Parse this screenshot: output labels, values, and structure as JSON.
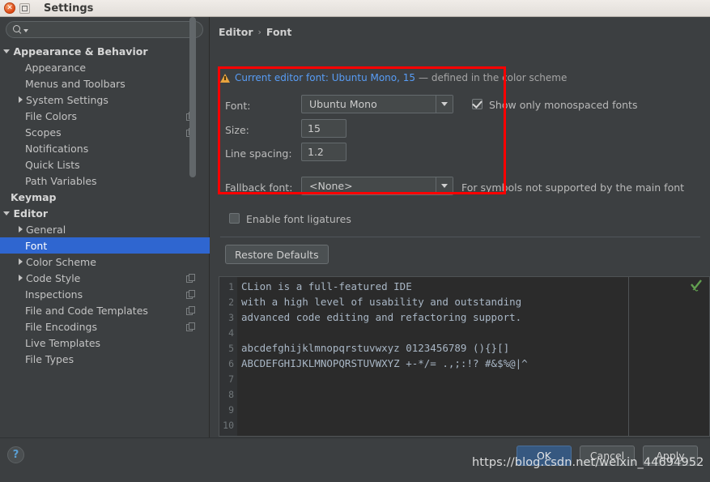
{
  "window": {
    "title": "Settings",
    "close_icon": "close-icon",
    "maximize_icon": "maximize-icon"
  },
  "search": {
    "value": "",
    "placeholder": "",
    "icon": "search-icon",
    "caret_icon": "chevron-down-icon"
  },
  "sidebar": {
    "items": [
      {
        "label": "Appearance & Behavior",
        "indent": 0,
        "twisty": "down",
        "bold": true,
        "copy": false,
        "selected": false
      },
      {
        "label": "Appearance",
        "indent": 1,
        "twisty": "none",
        "bold": false,
        "copy": false,
        "selected": false
      },
      {
        "label": "Menus and Toolbars",
        "indent": 1,
        "twisty": "none",
        "bold": false,
        "copy": false,
        "selected": false
      },
      {
        "label": "System Settings",
        "indent": 1,
        "twisty": "right",
        "bold": false,
        "copy": false,
        "selected": false
      },
      {
        "label": "File Colors",
        "indent": 1,
        "twisty": "none",
        "bold": false,
        "copy": true,
        "selected": false
      },
      {
        "label": "Scopes",
        "indent": 1,
        "twisty": "none",
        "bold": false,
        "copy": true,
        "selected": false
      },
      {
        "label": "Notifications",
        "indent": 1,
        "twisty": "none",
        "bold": false,
        "copy": false,
        "selected": false
      },
      {
        "label": "Quick Lists",
        "indent": 1,
        "twisty": "none",
        "bold": false,
        "copy": false,
        "selected": false
      },
      {
        "label": "Path Variables",
        "indent": 1,
        "twisty": "none",
        "bold": false,
        "copy": false,
        "selected": false
      },
      {
        "label": "Keymap",
        "indent": 0,
        "twisty": "none",
        "bold": true,
        "copy": false,
        "selected": false
      },
      {
        "label": "Editor",
        "indent": 0,
        "twisty": "down",
        "bold": true,
        "copy": false,
        "selected": false
      },
      {
        "label": "General",
        "indent": 1,
        "twisty": "right",
        "bold": false,
        "copy": false,
        "selected": false
      },
      {
        "label": "Font",
        "indent": 1,
        "twisty": "none",
        "bold": false,
        "copy": false,
        "selected": true
      },
      {
        "label": "Color Scheme",
        "indent": 1,
        "twisty": "right",
        "bold": false,
        "copy": false,
        "selected": false
      },
      {
        "label": "Code Style",
        "indent": 1,
        "twisty": "right",
        "bold": false,
        "copy": true,
        "selected": false
      },
      {
        "label": "Inspections",
        "indent": 1,
        "twisty": "none",
        "bold": false,
        "copy": true,
        "selected": false
      },
      {
        "label": "File and Code Templates",
        "indent": 1,
        "twisty": "none",
        "bold": false,
        "copy": true,
        "selected": false
      },
      {
        "label": "File Encodings",
        "indent": 1,
        "twisty": "none",
        "bold": false,
        "copy": true,
        "selected": false
      },
      {
        "label": "Live Templates",
        "indent": 1,
        "twisty": "none",
        "bold": false,
        "copy": false,
        "selected": false
      },
      {
        "label": "File Types",
        "indent": 1,
        "twisty": "none",
        "bold": false,
        "copy": false,
        "selected": false
      }
    ]
  },
  "breadcrumb": {
    "root": "Editor",
    "separator": "›",
    "current": "Font"
  },
  "warning": {
    "icon": "warning-triangle-icon",
    "link_text": "Current editor font: Ubuntu Mono, 15",
    "rest_text": "— defined in the color scheme"
  },
  "form": {
    "font_label": "Font:",
    "font_value": "Ubuntu Mono",
    "monospaced_label": "Show only monospaced fonts",
    "monospaced_checked": true,
    "size_label": "Size:",
    "size_value": "15",
    "line_spacing_label": "Line spacing:",
    "line_spacing_value": "1.2",
    "fallback_label": "Fallback font:",
    "fallback_value": "<None>",
    "fallback_note": "For symbols not supported by the main font",
    "ligatures_label": "Enable font ligatures",
    "ligatures_checked": false,
    "restore_defaults_label": "Restore Defaults"
  },
  "preview": {
    "checkmark_icon": "inspection-ok-checkmark-icon",
    "lines": [
      {
        "no": "1",
        "text": "CLion is a full-featured IDE"
      },
      {
        "no": "2",
        "text": "with a high level of usability and outstanding"
      },
      {
        "no": "3",
        "text": "advanced code editing and refactoring support."
      },
      {
        "no": "4",
        "text": ""
      },
      {
        "no": "5",
        "text": "abcdefghijklmnopqrstuvwxyz 0123456789 (){}[]"
      },
      {
        "no": "6",
        "text": "ABCDEFGHIJKLMNOPQRSTUVWXYZ +-*/= .,;:!? #&$%@|^"
      },
      {
        "no": "7",
        "text": ""
      },
      {
        "no": "8",
        "text": ""
      },
      {
        "no": "9",
        "text": ""
      },
      {
        "no": "10",
        "text": ""
      }
    ]
  },
  "footer": {
    "help_label": "?",
    "ok_label": "OK",
    "cancel_label": "Cancel",
    "apply_label": "Apply"
  },
  "watermark": {
    "text": "https://blog.csdn.net/weixin_44694952"
  },
  "colors": {
    "accent_selection": "#2f66d0",
    "ok_button": "#365880",
    "highlight_box": "#ff0000",
    "warning": "#e8a33d",
    "link": "#589df6",
    "code_text": "#a9b7c6"
  }
}
